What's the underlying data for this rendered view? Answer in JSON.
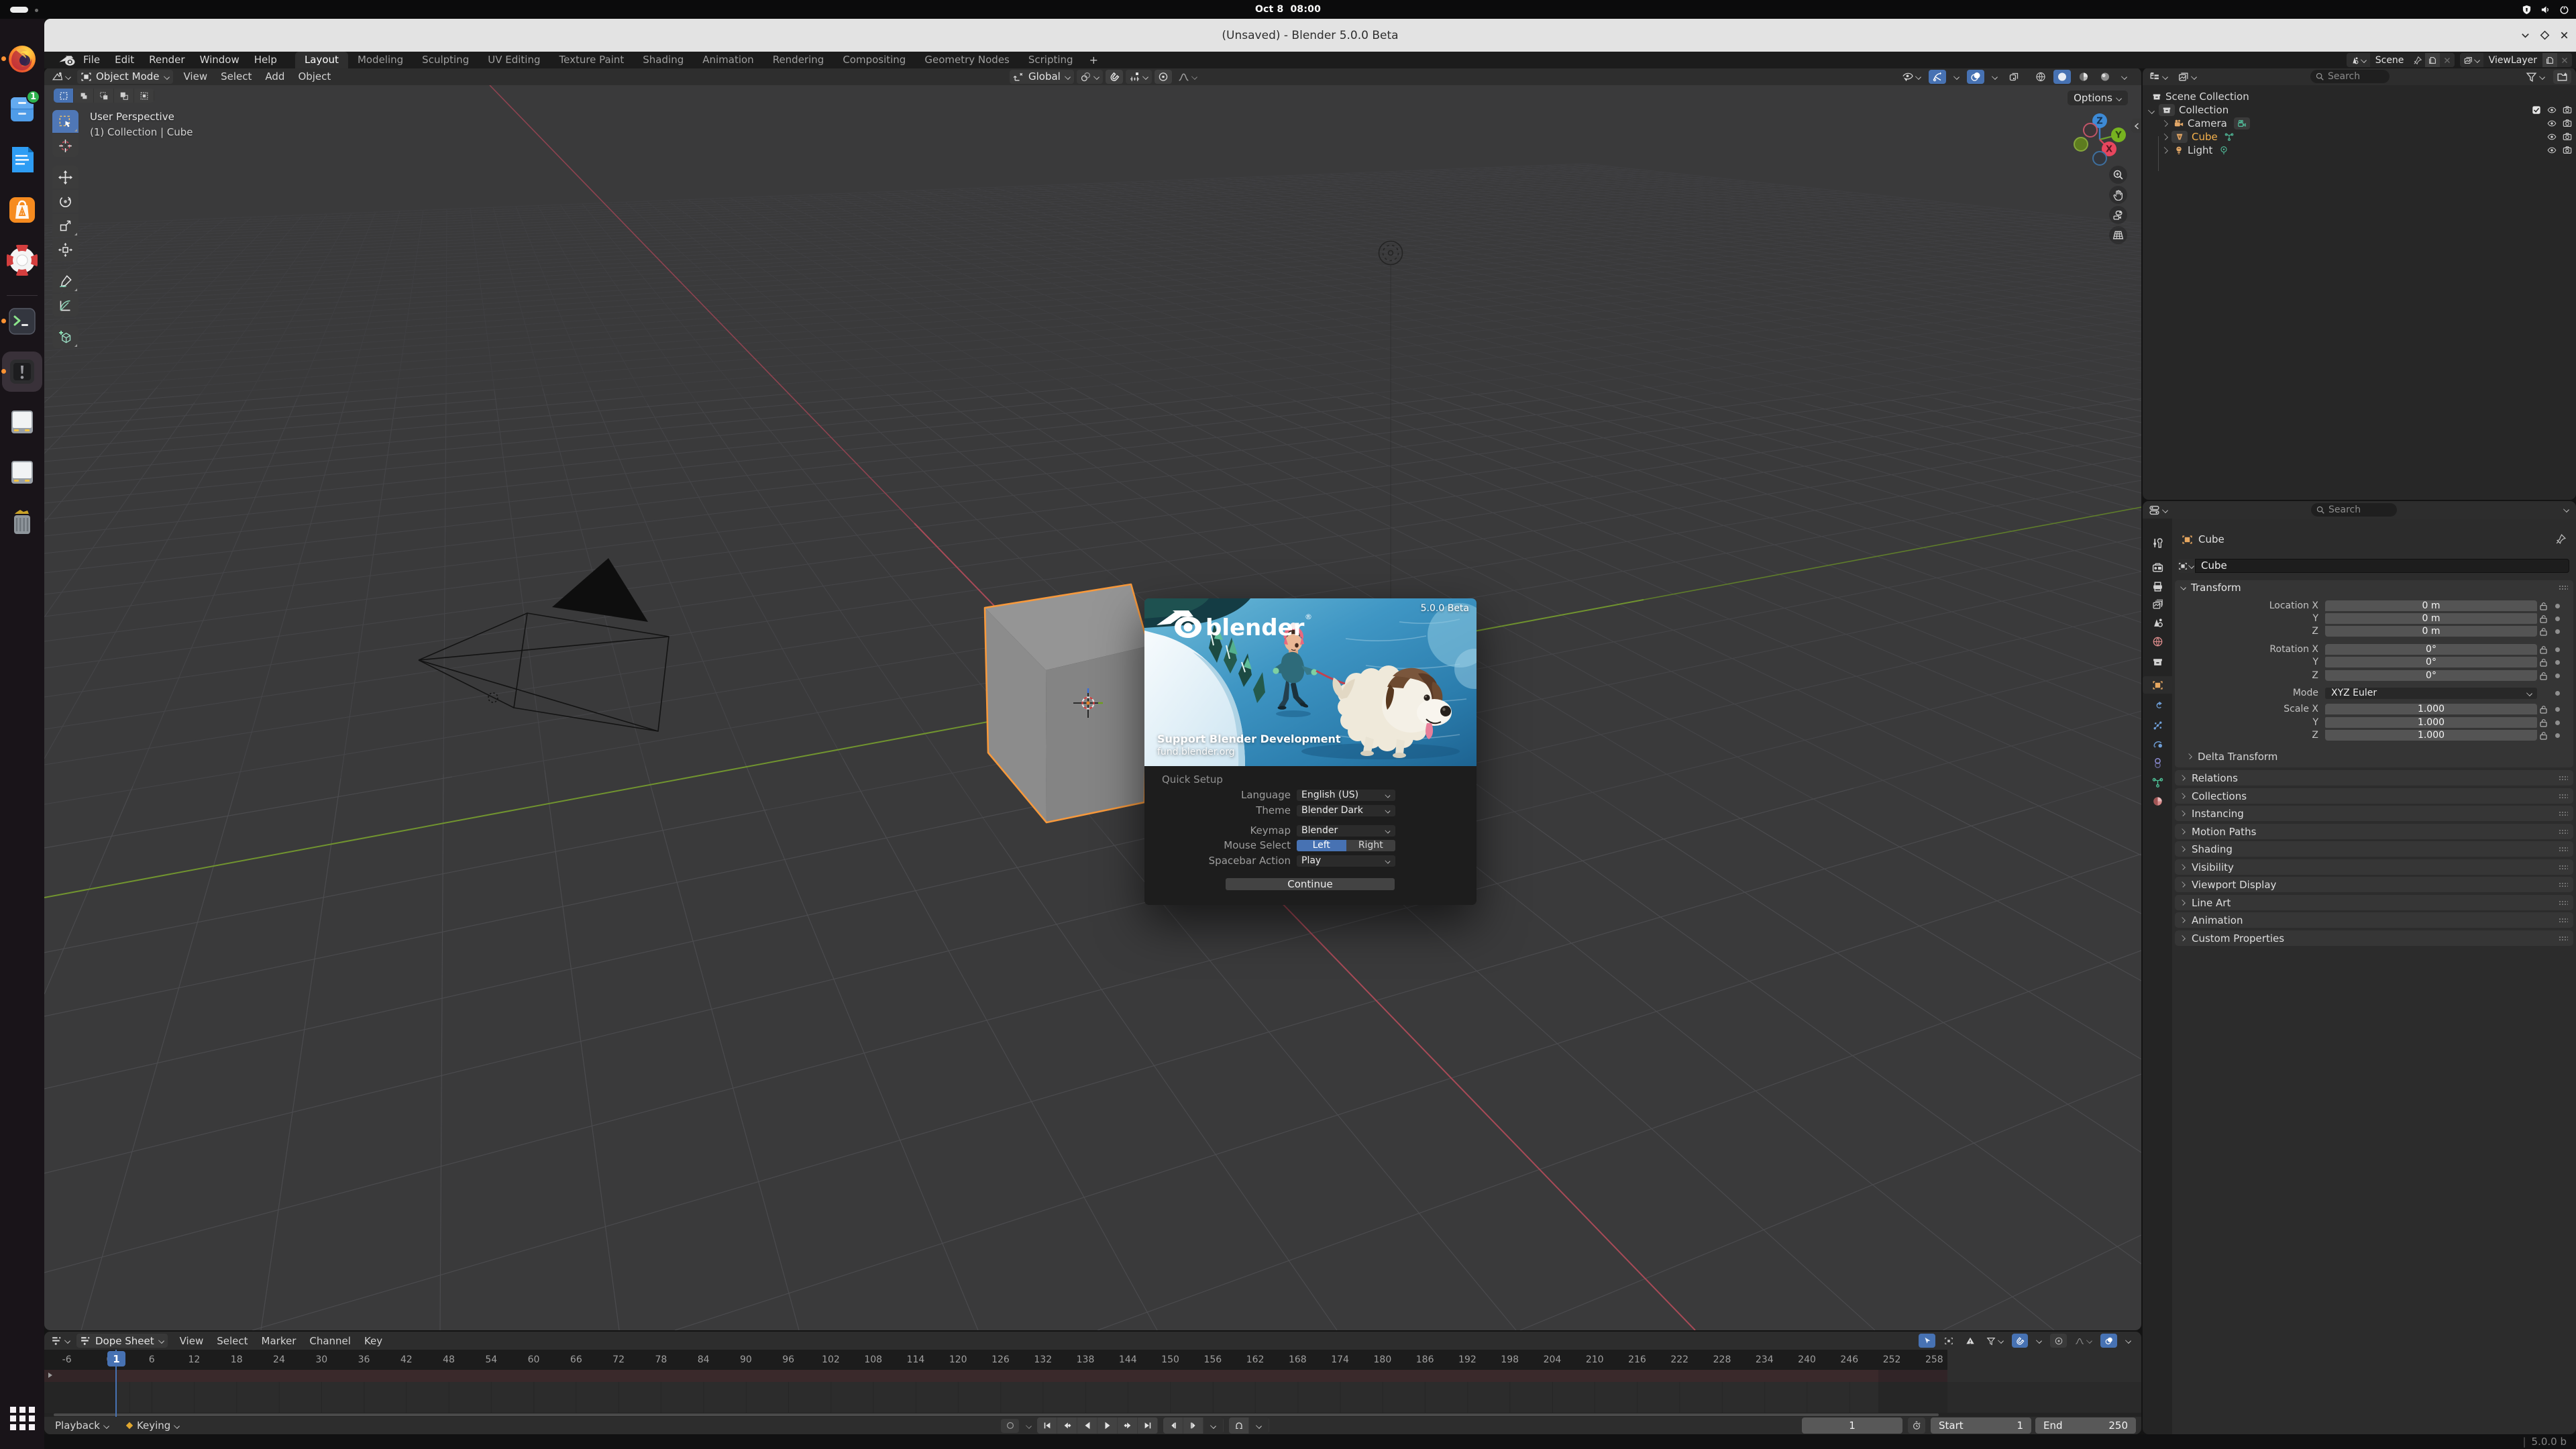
{
  "desktop": {
    "date": "Oct 8",
    "time": "08:00",
    "tray": [
      "security-shield",
      "volume",
      "power"
    ]
  },
  "dock": {
    "apps": [
      {
        "name": "firefox",
        "running": true
      },
      {
        "name": "file-manager",
        "badge": "1",
        "running": false
      },
      {
        "name": "text-editor",
        "running": false
      },
      {
        "name": "app-store",
        "running": false
      },
      {
        "name": "help",
        "running": false
      },
      {
        "name": "terminal",
        "running": true
      },
      {
        "name": "problem-reporter",
        "running": true,
        "focused": true
      },
      {
        "name": "disk-1",
        "running": false
      },
      {
        "name": "disk-2",
        "running": false
      },
      {
        "name": "trash",
        "running": false
      }
    ],
    "file_manager_badge": "1"
  },
  "window": {
    "title": "(Unsaved) - Blender 5.0.0 Beta"
  },
  "menubar": {
    "menus": [
      "File",
      "Edit",
      "Render",
      "Window",
      "Help"
    ],
    "workspaces": [
      {
        "label": "Layout",
        "state": "active"
      },
      {
        "label": "Modeling"
      },
      {
        "label": "Sculpting"
      },
      {
        "label": "UV Editing"
      },
      {
        "label": "Texture Paint"
      },
      {
        "label": "Shading"
      },
      {
        "label": "Animation"
      },
      {
        "label": "Rendering"
      },
      {
        "label": "Compositing"
      },
      {
        "label": "Geometry Nodes"
      },
      {
        "label": "Scripting"
      }
    ],
    "add_workspace": "+",
    "scene": {
      "label": "Scene"
    },
    "viewlayer": {
      "label": "ViewLayer"
    }
  },
  "viewport": {
    "header": {
      "mode": "Object Mode",
      "menus": [
        "View",
        "Select",
        "Add",
        "Object"
      ],
      "orientation": "Global"
    },
    "overlay": {
      "line1": "User Perspective",
      "line2": "(1) Collection | Cube"
    },
    "options_label": "Options",
    "gizmo": {
      "x": "X",
      "y": "Y",
      "z": "Z"
    }
  },
  "splash": {
    "version": "5.0.0 Beta",
    "brand": "blender",
    "brand_mark": "®",
    "support_title": "Support Blender Development",
    "support_url": "fund.blender.org",
    "quick_setup": "Quick Setup",
    "language_label": "Language",
    "language_value": "English (US)",
    "theme_label": "Theme",
    "theme_value": "Blender Dark",
    "keymap_label": "Keymap",
    "keymap_value": "Blender",
    "mouse_label": "Mouse Select",
    "mouse_left": "Left",
    "mouse_right": "Right",
    "spacebar_label": "Spacebar Action",
    "spacebar_value": "Play",
    "continue_label": "Continue"
  },
  "outliner": {
    "search_placeholder": "Search",
    "rows": {
      "scene_collection": "Scene Collection",
      "collection": "Collection",
      "camera": "Camera",
      "cube": "Cube",
      "light": "Light"
    }
  },
  "properties": {
    "search_placeholder": "Search",
    "breadcrumb": "Cube",
    "name_value": "Cube",
    "transform_title": "Transform",
    "location_rows": [
      {
        "label": "Location X",
        "value": "0 m",
        "cls": "grp-top"
      },
      {
        "label": "Y",
        "value": "0 m",
        "cls": "grp-mid"
      },
      {
        "label": "Z",
        "value": "0 m",
        "cls": "grp-bot"
      }
    ],
    "rotation_rows": [
      {
        "label": "Rotation X",
        "value": "0°",
        "cls": "grp-top"
      },
      {
        "label": "Y",
        "value": "0°",
        "cls": "grp-mid"
      },
      {
        "label": "Z",
        "value": "0°",
        "cls": "grp-bot"
      }
    ],
    "mode_label": "Mode",
    "mode_value": "XYZ Euler",
    "scale_rows": [
      {
        "label": "Scale X",
        "value": "1.000",
        "cls": "grp-top"
      },
      {
        "label": "Y",
        "value": "1.000",
        "cls": "grp-mid"
      },
      {
        "label": "Z",
        "value": "1.000",
        "cls": "grp-bot"
      }
    ],
    "delta_transform": "Delta Transform",
    "panels": [
      "Relations",
      "Collections",
      "Instancing",
      "Motion Paths",
      "Shading",
      "Visibility",
      "Viewport Display",
      "Line Art",
      "Animation",
      "Custom Properties"
    ]
  },
  "timeline": {
    "editor_label": "Dope Sheet",
    "menus": [
      "View",
      "Select",
      "Marker",
      "Channel",
      "Key"
    ],
    "ruler": [
      "-6",
      "0",
      "6",
      "12",
      "18",
      "24",
      "30",
      "36",
      "42",
      "48",
      "54",
      "60",
      "66",
      "72",
      "78",
      "84",
      "90",
      "96",
      "102",
      "108",
      "114",
      "120",
      "126",
      "132",
      "138",
      "144",
      "150",
      "156",
      "162",
      "168",
      "174",
      "180",
      "186",
      "192",
      "198",
      "204",
      "210",
      "216",
      "222",
      "228",
      "234",
      "240",
      "246",
      "252",
      "258"
    ],
    "playhead": "1",
    "playback_label": "Playback",
    "keying_label": "Keying",
    "frame_value": "1",
    "start_label": "Start",
    "start_value": "1",
    "end_label": "End",
    "end_value": "250"
  },
  "statusbar": {
    "separator": "|",
    "version": "5.0.0 b"
  }
}
